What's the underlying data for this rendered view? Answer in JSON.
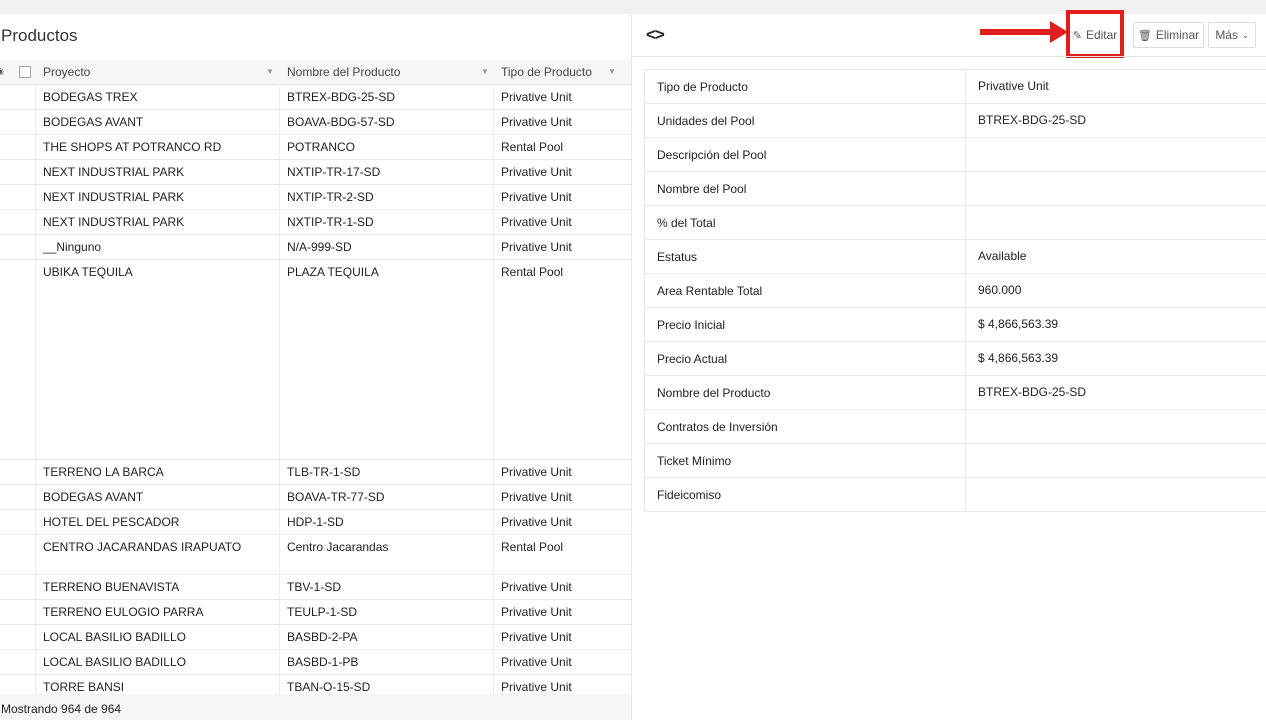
{
  "list": {
    "title": "Productos",
    "columns": [
      "Proyecto",
      "Nombre del Producto",
      "Tipo de Producto"
    ],
    "rows": [
      {
        "proyecto": "BODEGAS TREX",
        "nombre": "BTREX-BDG-25-SD",
        "tipo": "Privative Unit"
      },
      {
        "proyecto": "BODEGAS AVANT",
        "nombre": "BOAVA-BDG-57-SD",
        "tipo": "Privative Unit"
      },
      {
        "proyecto": "THE SHOPS AT POTRANCO RD",
        "nombre": "POTRANCO",
        "tipo": "Rental Pool"
      },
      {
        "proyecto": "NEXT INDUSTRIAL PARK",
        "nombre": "NXTIP-TR-17-SD",
        "tipo": "Privative Unit"
      },
      {
        "proyecto": "NEXT INDUSTRIAL PARK",
        "nombre": "NXTIP-TR-2-SD",
        "tipo": "Privative Unit"
      },
      {
        "proyecto": "NEXT INDUSTRIAL PARK",
        "nombre": "NXTIP-TR-1-SD",
        "tipo": "Privative Unit"
      },
      {
        "proyecto": "__Ninguno",
        "nombre": "N/A-999-SD",
        "tipo": "Privative Unit"
      },
      {
        "proyecto": "UBIKA TEQUILA",
        "nombre": "PLAZA TEQUILA",
        "tipo": "Rental Pool"
      },
      {
        "proyecto": "TERRENO LA BARCA",
        "nombre": "TLB-TR-1-SD",
        "tipo": "Privative Unit"
      },
      {
        "proyecto": "BODEGAS AVANT",
        "nombre": "BOAVA-TR-77-SD",
        "tipo": "Privative Unit"
      },
      {
        "proyecto": "HOTEL DEL PESCADOR",
        "nombre": "HDP-1-SD",
        "tipo": "Privative Unit"
      },
      {
        "proyecto": "CENTRO JACARANDAS IRAPUATO",
        "nombre": "Centro Jacarandas",
        "tipo": "Rental Pool"
      },
      {
        "proyecto": "TERRENO BUENAVISTA",
        "nombre": "TBV-1-SD",
        "tipo": "Privative Unit"
      },
      {
        "proyecto": "TERRENO EULOGIO PARRA",
        "nombre": "TEULP-1-SD",
        "tipo": "Privative Unit"
      },
      {
        "proyecto": "LOCAL BASILIO BADILLO",
        "nombre": "BASBD-2-PA",
        "tipo": "Privative Unit"
      },
      {
        "proyecto": "LOCAL BASILIO BADILLO",
        "nombre": "BASBD-1-PB",
        "tipo": "Privative Unit"
      },
      {
        "proyecto": "TORRE BANSI",
        "nombre": "TBAN-O-15-SD",
        "tipo": "Privative Unit"
      }
    ],
    "footer": "Mostrando 964 de 964"
  },
  "detail": {
    "toolbar": {
      "edit": "Editar",
      "delete": "Eliminar",
      "more": "Más"
    },
    "icons": {
      "nav": "code-brackets-icon",
      "edit": "pencil-icon",
      "delete": "trash-icon",
      "more": "chevron-down-icon"
    },
    "annotation_color": "#e31c1c",
    "fields": [
      {
        "label": "Tipo de Producto",
        "value": "Privative Unit"
      },
      {
        "label": "Unidades del Pool",
        "value": "BTREX-BDG-25-SD"
      },
      {
        "label": "Descripción del Pool",
        "value": ""
      },
      {
        "label": "Nombre del Pool",
        "value": ""
      },
      {
        "label": "% del Total",
        "value": ""
      },
      {
        "label": "Estatus",
        "value": "Available"
      },
      {
        "label": "Area Rentable Total",
        "value": "960.000"
      },
      {
        "label": "Precio Inicial",
        "value": "$ 4,866,563.39"
      },
      {
        "label": "Precio Actual",
        "value": "$ 4,866,563.39"
      },
      {
        "label": "Nombre del Producto",
        "value": "BTREX-BDG-25-SD"
      },
      {
        "label": "Contratos de Inversión",
        "value": ""
      },
      {
        "label": "Ticket Mínimo",
        "value": ""
      },
      {
        "label": "Fideicomiso",
        "value": ""
      }
    ]
  }
}
